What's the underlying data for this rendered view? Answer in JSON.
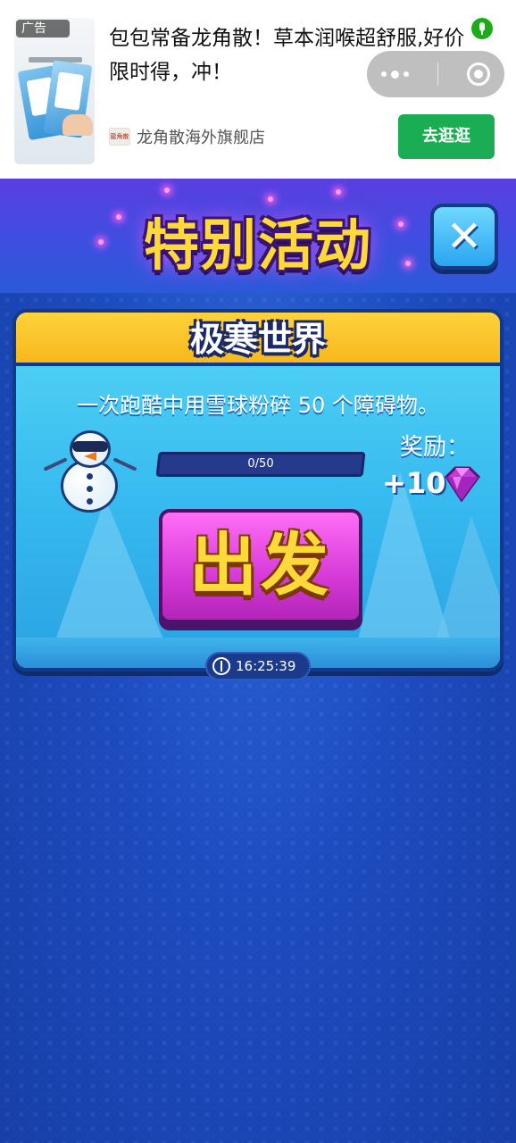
{
  "ad": {
    "tag": "广告",
    "title": "包包常备龙角散！草本润喉超舒服,好价限时得，冲！",
    "store": "龙角散海外旗舰店",
    "store_logo": "龍角散",
    "button": "去逛逛",
    "colors": {
      "button": "#1aad53",
      "capsule": "#bfbfbf"
    }
  },
  "game": {
    "title": "特别活动",
    "close_icon": "close-x-icon",
    "card": {
      "title": "极寒世界",
      "description": "一次跑酷中用雪球粉碎 50 个障碍物。",
      "progress": {
        "label": "0/50",
        "fraction": 0
      },
      "reward_label": "奖励：",
      "reward_value": "+10",
      "reward_icon": "gem-icon",
      "go_button": "出发"
    },
    "timer": "16:25:39"
  }
}
